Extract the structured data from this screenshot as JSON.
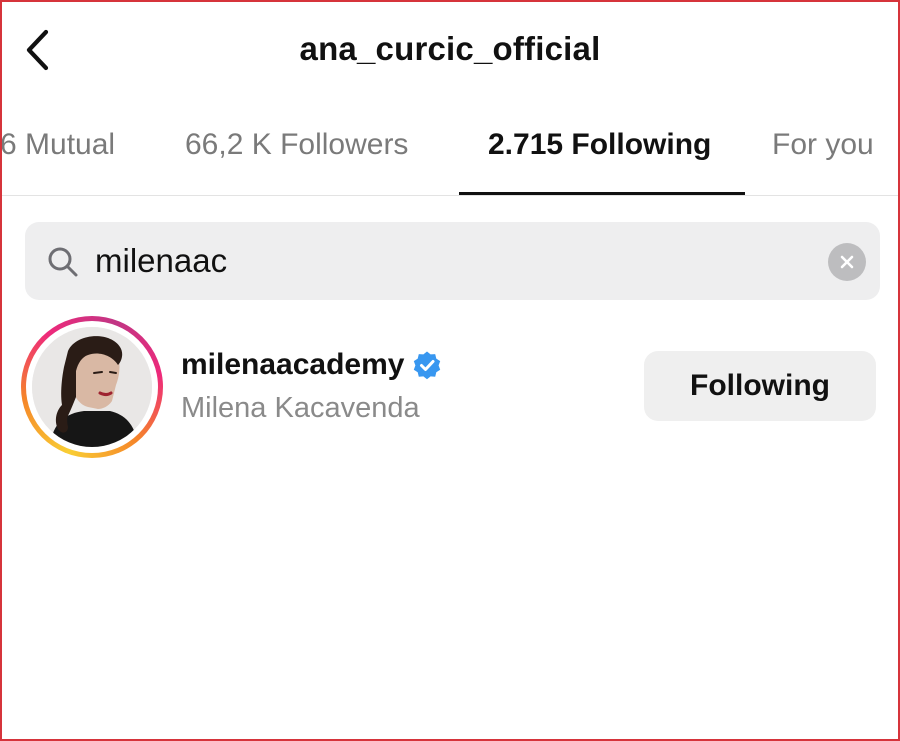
{
  "header": {
    "title": "ana_curcic_official",
    "back_icon": "chevron-left-icon"
  },
  "tabs": [
    {
      "label": "6 Mutual",
      "active": false
    },
    {
      "label": "66,2 K Followers",
      "active": false
    },
    {
      "label": "2.715 Following",
      "active": true
    },
    {
      "label": "For you",
      "active": false
    }
  ],
  "search": {
    "value": "milenaac",
    "icon": "search-icon",
    "clear_icon": "clear-icon"
  },
  "results": [
    {
      "username": "milenaacademy",
      "verified": true,
      "full_name": "Milena Kacavenda",
      "button_label": "Following",
      "has_story_ring": true
    }
  ],
  "colors": {
    "frame_border": "#d6343b",
    "verified_badge": "#3897f0",
    "search_bg": "#eeeeef",
    "button_bg": "#efefef",
    "secondary_text": "#8a8a8a"
  }
}
